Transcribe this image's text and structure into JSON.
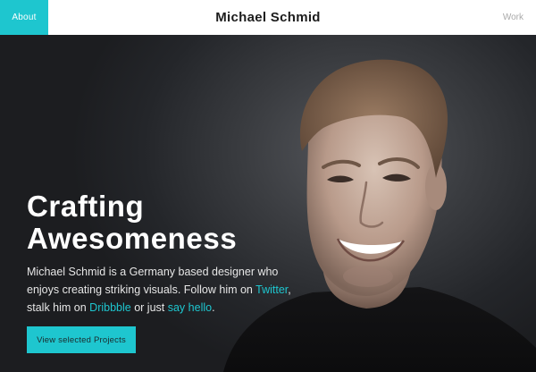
{
  "nav": {
    "about_label": "About",
    "site_title": "Michael Schmid",
    "work_label": "Work"
  },
  "hero": {
    "headline_line1": "Crafting",
    "headline_line2": "Awesomeness",
    "bio_part1": "Michael Schmid is a Germany based designer who enjoys creating striking visuals. Follow him on ",
    "twitter_link": "Twitter",
    "bio_part2": ", stalk him on ",
    "dribbble_link": "Dribbble",
    "bio_part3": " or just ",
    "say_hello_link": "say hello",
    "bio_part4": ".",
    "cta_label": "View selected Projects"
  },
  "colors": {
    "accent": "#1ec6cf",
    "background": "#1d1f22",
    "topbar": "#ffffff"
  }
}
